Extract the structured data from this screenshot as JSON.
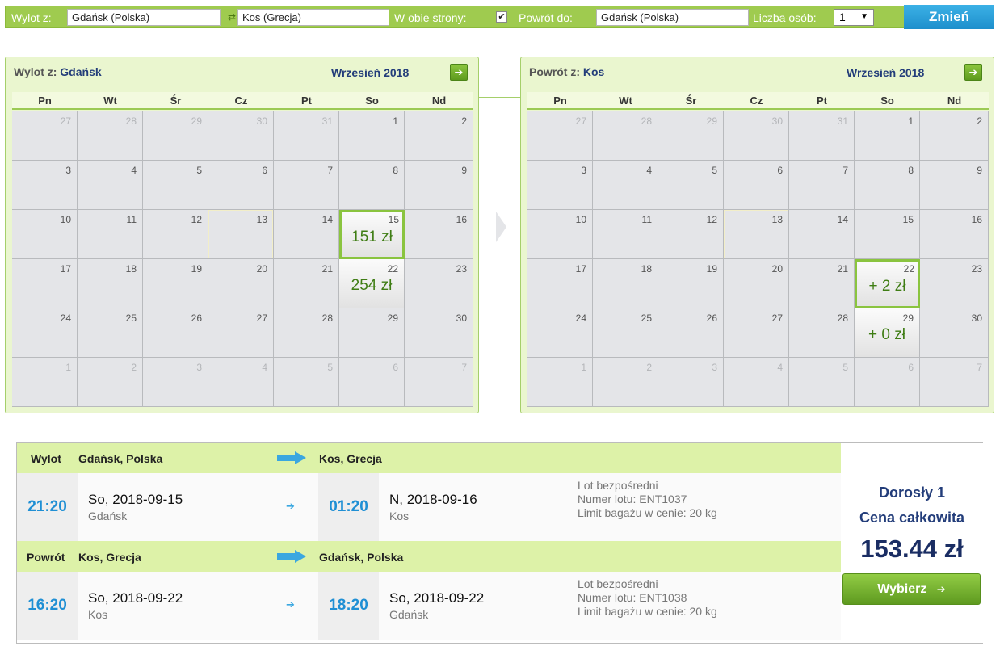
{
  "search": {
    "from_label": "Wylot z:",
    "from_value": "Gdańsk (Polska)",
    "to_value": "Kos (Grecja)",
    "roundtrip_label": "W obie strony:",
    "roundtrip_checked": "✔",
    "return_label": "Powrót do:",
    "return_value": "Gdańsk (Polska)",
    "persons_label": "Liczba osób:",
    "persons_value": "1",
    "change_button": "Zmień"
  },
  "calendars": [
    {
      "title_prefix": "Wylot z:",
      "city": "Gdańsk",
      "month": "Wrzesień 2018",
      "weekdays": [
        "Pn",
        "Wt",
        "Śr",
        "Cz",
        "Pt",
        "So",
        "Nd"
      ],
      "days": [
        "27",
        "28",
        "29",
        "30",
        "31",
        "1",
        "2",
        "3",
        "4",
        "5",
        "6",
        "7",
        "8",
        "9",
        "10",
        "11",
        "12",
        "13",
        "14",
        "15",
        "16",
        "17",
        "18",
        "19",
        "20",
        "21",
        "22",
        "23",
        "24",
        "25",
        "26",
        "27",
        "28",
        "29",
        "30",
        "1",
        "2",
        "3",
        "4",
        "5",
        "6",
        "7"
      ],
      "prices": {
        "19": "151 zł",
        "26": "254 zł"
      },
      "selected_index": 19
    },
    {
      "title_prefix": "Powrót z:",
      "city": "Kos",
      "month": "Wrzesień 2018",
      "weekdays": [
        "Pn",
        "Wt",
        "Śr",
        "Cz",
        "Pt",
        "So",
        "Nd"
      ],
      "days": [
        "27",
        "28",
        "29",
        "30",
        "31",
        "1",
        "2",
        "3",
        "4",
        "5",
        "6",
        "7",
        "8",
        "9",
        "10",
        "11",
        "12",
        "13",
        "14",
        "15",
        "16",
        "17",
        "18",
        "19",
        "20",
        "21",
        "22",
        "23",
        "24",
        "25",
        "26",
        "27",
        "28",
        "29",
        "30",
        "1",
        "2",
        "3",
        "4",
        "5",
        "6",
        "7"
      ],
      "prices": {
        "26": "+ 2 zł",
        "33": "+ 0 zł"
      },
      "selected_index": 26
    }
  ],
  "outbound": {
    "label": "Wylot",
    "from": "Gdańsk, Polska",
    "to": "Kos, Grecja",
    "dep_time": "21:20",
    "dep_date": "So, 2018-09-15",
    "dep_city": "Gdańsk",
    "arr_time": "01:20",
    "arr_date": "N, 2018-09-16",
    "arr_city": "Kos",
    "info_type": "Lot bezpośredni",
    "info_flight": "Numer lotu: ENT1037",
    "info_baggage": "Limit bagażu w cenie: 20 kg"
  },
  "inbound": {
    "label": "Powrót",
    "from": "Kos, Grecja",
    "to": "Gdańsk, Polska",
    "dep_time": "16:20",
    "dep_date": "So, 2018-09-22",
    "dep_city": "Kos",
    "arr_time": "18:20",
    "arr_date": "So, 2018-09-22",
    "arr_city": "Gdańsk",
    "info_type": "Lot bezpośredni",
    "info_flight": "Numer lotu: ENT1038",
    "info_baggage": "Limit bagażu w cenie: 20 kg"
  },
  "price": {
    "adult": "Dorosły 1",
    "total_label": "Cena całkowita",
    "amount": "153.44 zł",
    "choose_button": "Wybierz"
  },
  "colors": {
    "accent_green": "#9fcb4f",
    "price_green": "#3f7d14",
    "time_blue": "#1f8fd4",
    "navy": "#233d7a",
    "button_blue": "#2ba0dc"
  },
  "icons": {
    "swap": "swap-icon",
    "next_month": "arrow-right-icon",
    "route_arrow": "arrow-right-icon",
    "choose_arrow": "arrow-right-icon"
  }
}
